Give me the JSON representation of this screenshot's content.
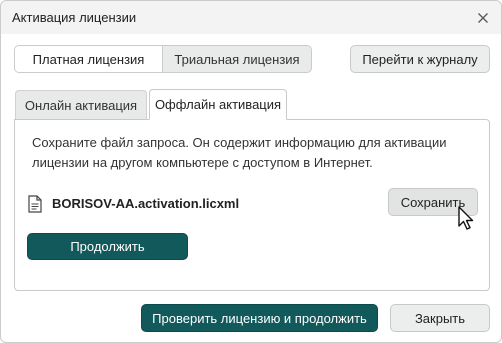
{
  "window": {
    "title": "Активация лицензии"
  },
  "license_type": {
    "options": [
      "Платная лицензия",
      "Триальная лицензия"
    ],
    "selected": "Платная лицензия"
  },
  "header_actions": {
    "journal_label": "Перейти к журналу"
  },
  "tabs": [
    {
      "label": "Онлайн активация",
      "active": false
    },
    {
      "label": "Оффлайн активация",
      "active": true
    }
  ],
  "offline_panel": {
    "description": "Сохраните файл запроса. Он содержит информацию для активации лицензии на другом компьютере с доступом в Интернет.",
    "file_name": "BORISOV-AA.activation.licxml",
    "save_label": "Сохранить",
    "continue_label": "Продолжить"
  },
  "footer": {
    "check_label": "Проверить лицензию и продолжить",
    "close_label": "Закрыть"
  },
  "colors": {
    "primary": "#11595a",
    "titlebar": "#f3f3f3"
  },
  "icons": {
    "close": "close-icon",
    "file": "file-icon",
    "cursor": "mouse-pointer-icon"
  }
}
